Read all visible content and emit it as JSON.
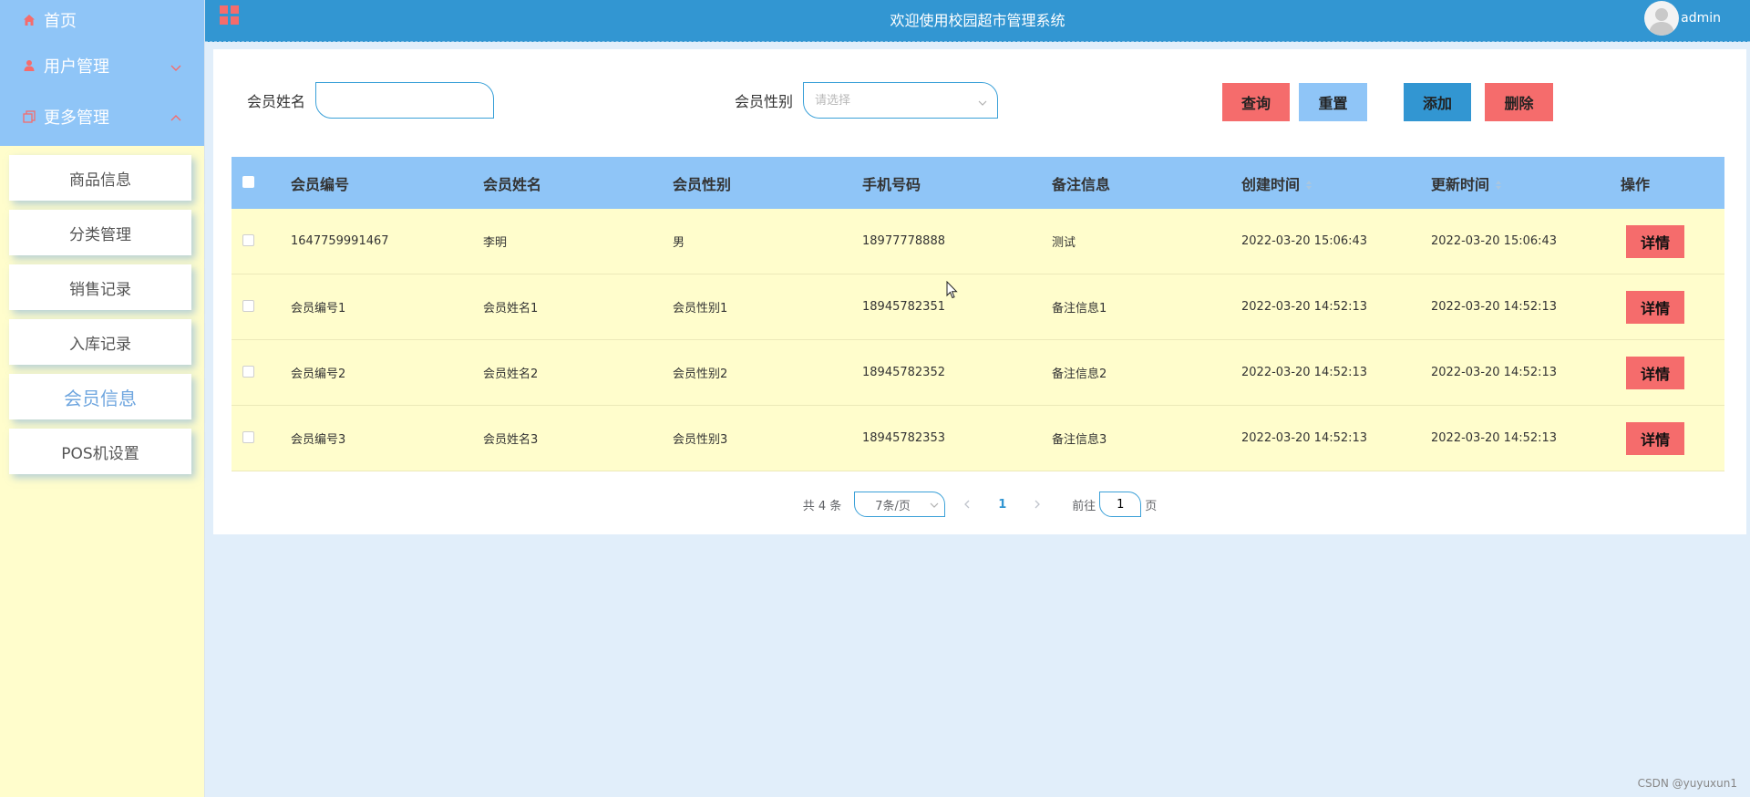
{
  "sidebar": {
    "menu": [
      {
        "label": "首页",
        "icon": "home-icon"
      },
      {
        "label": "用户管理",
        "icon": "user-icon",
        "expanded": false
      },
      {
        "label": "更多管理",
        "icon": "copy-icon",
        "expanded": true
      }
    ],
    "submenu": [
      {
        "label": "商品信息",
        "active": false
      },
      {
        "label": "分类管理",
        "active": false
      },
      {
        "label": "销售记录",
        "active": false
      },
      {
        "label": "入库记录",
        "active": false
      },
      {
        "label": "会员信息",
        "active": true
      },
      {
        "label": "POS机设置",
        "active": false
      }
    ]
  },
  "header": {
    "title": "欢迎使用校园超市管理系统",
    "username": "admin"
  },
  "search": {
    "name_label": "会员姓名",
    "name_value": "",
    "gender_label": "会员性别",
    "gender_placeholder": "请选择"
  },
  "buttons": {
    "query": "查询",
    "reset": "重置",
    "add": "添加",
    "delete": "删除"
  },
  "table": {
    "headers": [
      "会员编号",
      "会员姓名",
      "会员性别",
      "手机号码",
      "备注信息",
      "创建时间",
      "更新时间",
      "操作"
    ],
    "detail_label": "详情",
    "rows": [
      {
        "id": "1647759991467",
        "name": "李明",
        "gender": "男",
        "phone": "18977778888",
        "note": "测试",
        "created": "2022-03-20 15:06:43",
        "updated": "2022-03-20 15:06:43"
      },
      {
        "id": "会员编号1",
        "name": "会员姓名1",
        "gender": "会员性别1",
        "phone": "18945782351",
        "note": "备注信息1",
        "created": "2022-03-20 14:52:13",
        "updated": "2022-03-20 14:52:13"
      },
      {
        "id": "会员编号2",
        "name": "会员姓名2",
        "gender": "会员性别2",
        "phone": "18945782352",
        "note": "备注信息2",
        "created": "2022-03-20 14:52:13",
        "updated": "2022-03-20 14:52:13"
      },
      {
        "id": "会员编号3",
        "name": "会员姓名3",
        "gender": "会员性别3",
        "phone": "18945782353",
        "note": "备注信息3",
        "created": "2022-03-20 14:52:13",
        "updated": "2022-03-20 14:52:13"
      }
    ]
  },
  "pagination": {
    "total": "共 4 条",
    "page_size": "7条/页",
    "current_page": "1",
    "goto_label": "前往",
    "goto_value": "1",
    "page_suffix": "页"
  },
  "watermark": "CSDN @yuyuxun1",
  "colors": {
    "header": "#3296d2",
    "sidebar_menu": "#8fc5f7",
    "sidebar_bg": "#fffdcc",
    "table_header": "#8fc5f7",
    "row_bg": "#fffdcc",
    "danger": "#f56c6c",
    "page_bg": "#e1eefa"
  }
}
